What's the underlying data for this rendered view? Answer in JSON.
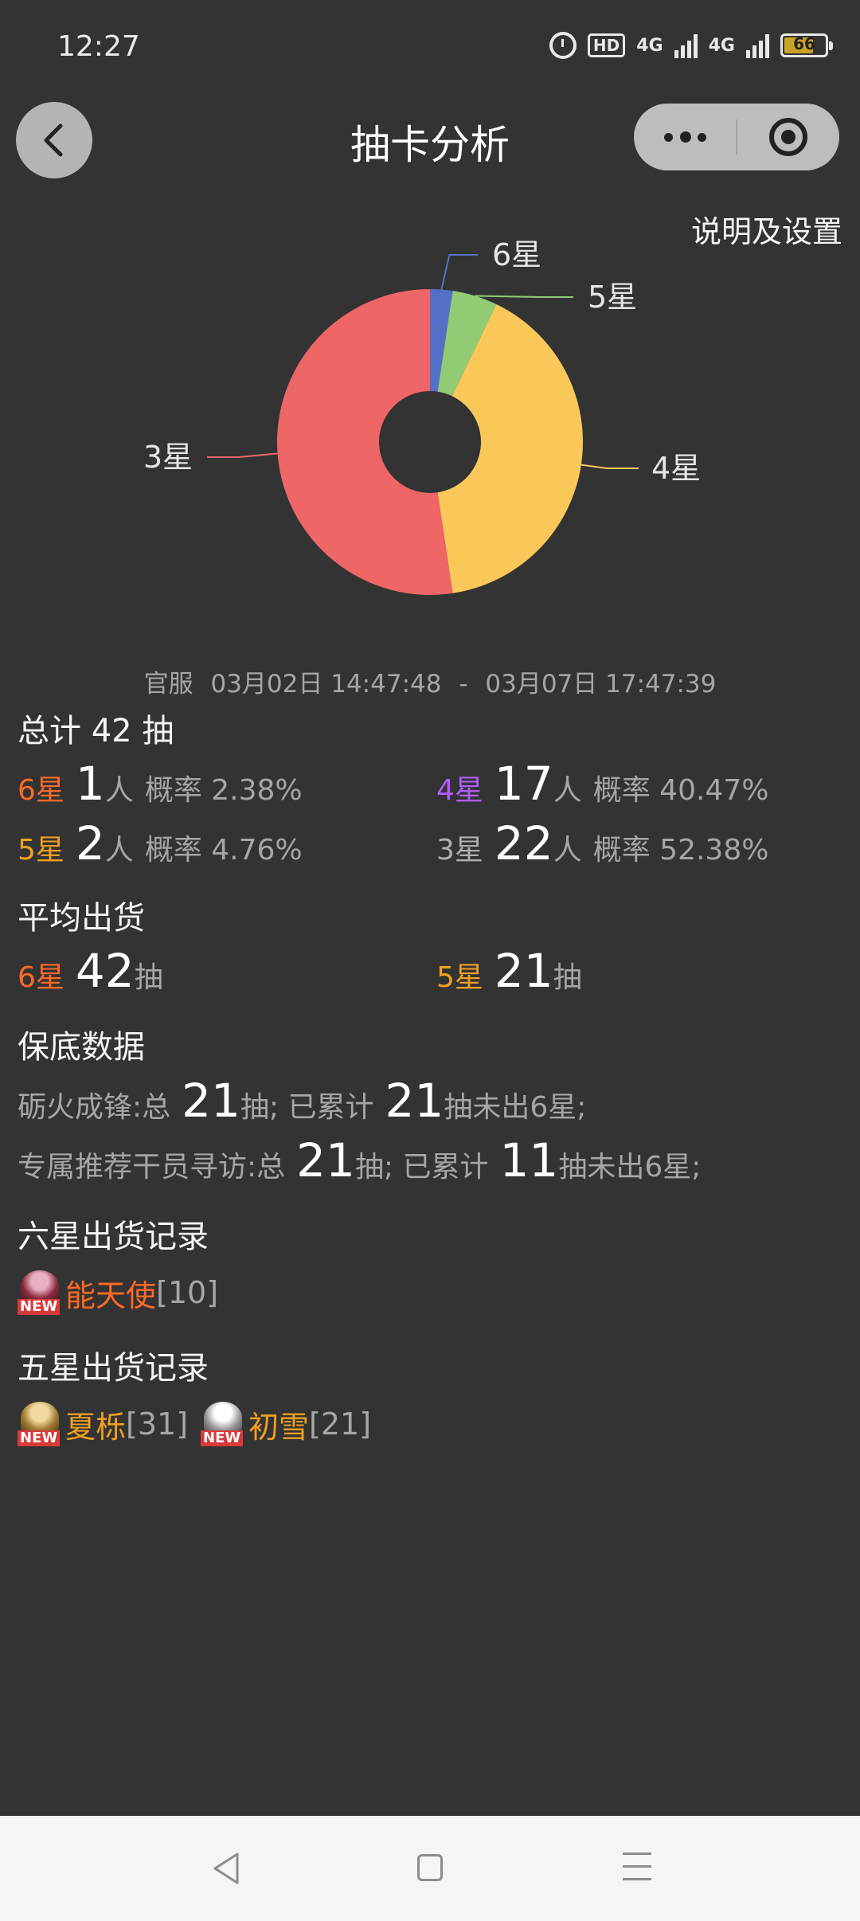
{
  "status_bar": {
    "time": "12:27",
    "network1": "4G",
    "network2": "4G",
    "battery": "66"
  },
  "header": {
    "title": "抽卡分析"
  },
  "settings_link": "说明及设置",
  "chart_data": {
    "type": "pie",
    "donut": true,
    "slices": [
      {
        "label": "6星",
        "value": 1,
        "color": "#5470c6"
      },
      {
        "label": "5星",
        "value": 2,
        "color": "#91cc75"
      },
      {
        "label": "4星",
        "value": 17,
        "color": "#fac858"
      },
      {
        "label": "3星",
        "value": 22,
        "color": "#ee6666"
      }
    ]
  },
  "date_range": {
    "server": "官服",
    "start": "03月02日 14:47:48",
    "sep": "-",
    "end": "03月07日 17:47:39"
  },
  "summary": {
    "total_label": "总计 42 抽",
    "items": [
      {
        "star": "6星",
        "count": "1",
        "unit": "人",
        "rate": "概率 2.38%"
      },
      {
        "star": "4星",
        "count": "17",
        "unit": "人",
        "rate": "概率 40.47%"
      },
      {
        "star": "5星",
        "count": "2",
        "unit": "人",
        "rate": "概率 4.76%"
      },
      {
        "star": "3星",
        "count": "22",
        "unit": "人",
        "rate": "概率 52.38%"
      }
    ]
  },
  "average": {
    "title": "平均出货",
    "items": [
      {
        "star": "6星",
        "value": "42",
        "unit": "抽"
      },
      {
        "star": "5星",
        "value": "21",
        "unit": "抽"
      }
    ]
  },
  "pity": {
    "title": "保底数据",
    "rows": [
      {
        "name": "砺火成锋:总",
        "total": "21",
        "mid": "抽;  已累计",
        "count": "21",
        "suffix": "抽未出6星;"
      },
      {
        "name": "专属推荐干员寻访:总",
        "total": "21",
        "mid": "抽;  已累计",
        "count": "11",
        "suffix": "抽未出6星;"
      }
    ]
  },
  "six_star_records": {
    "title": "六星出货记录",
    "items": [
      {
        "badge": "NEW",
        "name": "能天使",
        "count": "[10]"
      }
    ]
  },
  "five_star_records": {
    "title": "五星出货记录",
    "items": [
      {
        "badge": "NEW",
        "name": "夏栎",
        "count": "[31]"
      },
      {
        "badge": "NEW",
        "name": "初雪",
        "count": "[21]"
      }
    ]
  }
}
